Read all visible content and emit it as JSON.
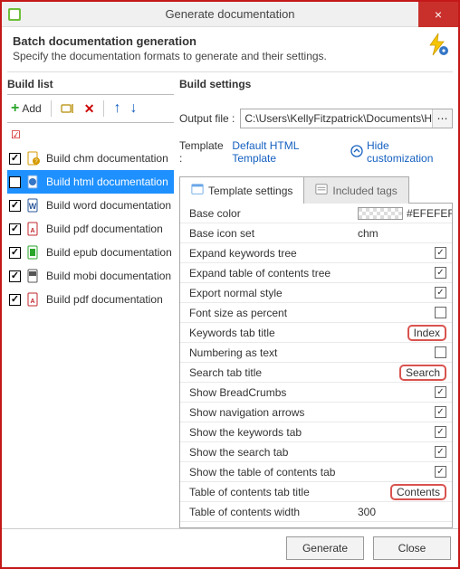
{
  "window": {
    "title": "Generate documentation",
    "close": "×"
  },
  "header": {
    "title": "Batch documentation generation",
    "subtitle": "Specify the documentation formats to generate and their settings."
  },
  "build_list": {
    "title": "Build list",
    "add_label": "Add",
    "items": [
      {
        "label": "Build chm documentation",
        "checked": true,
        "selected": false
      },
      {
        "label": "Build html documentation",
        "checked": false,
        "selected": true
      },
      {
        "label": "Build word documentation",
        "checked": true,
        "selected": false
      },
      {
        "label": "Build pdf documentation",
        "checked": true,
        "selected": false
      },
      {
        "label": "Build epub documentation",
        "checked": true,
        "selected": false
      },
      {
        "label": "Build mobi documentation",
        "checked": true,
        "selected": false
      },
      {
        "label": "Build pdf documentation",
        "checked": true,
        "selected": false
      }
    ]
  },
  "settings": {
    "title": "Build settings",
    "output_label": "Output file :",
    "output_value": "C:\\Users\\KellyFitzpatrick\\Documents\\HelpNDo",
    "template_label": "Template :",
    "template_value": "Default HTML Template",
    "hide_customization": "Hide customization",
    "tabs": {
      "template": "Template settings",
      "included": "Included tags"
    },
    "properties": [
      {
        "name": "Base color",
        "type": "color",
        "value": "#EFEFEF"
      },
      {
        "name": "Base icon set",
        "type": "text",
        "value": "chm"
      },
      {
        "name": "Expand keywords tree",
        "type": "check",
        "checked": true
      },
      {
        "name": "Expand table of contents tree",
        "type": "check",
        "checked": true
      },
      {
        "name": "Export normal style",
        "type": "check",
        "checked": true
      },
      {
        "name": "Font size as percent",
        "type": "check",
        "checked": false
      },
      {
        "name": "Keywords tab title",
        "type": "hltext",
        "value": "Index"
      },
      {
        "name": "Numbering as text",
        "type": "check",
        "checked": false
      },
      {
        "name": "Search tab title",
        "type": "hltext",
        "value": "Search"
      },
      {
        "name": "Show BreadCrumbs",
        "type": "check",
        "checked": true
      },
      {
        "name": "Show navigation arrows",
        "type": "check",
        "checked": true
      },
      {
        "name": "Show the keywords tab",
        "type": "check",
        "checked": true
      },
      {
        "name": "Show the search tab",
        "type": "check",
        "checked": true
      },
      {
        "name": "Show the table of contents tab",
        "type": "check",
        "checked": true
      },
      {
        "name": "Table of contents tab title",
        "type": "hltext",
        "value": "Contents"
      },
      {
        "name": "Table of contents width",
        "type": "text",
        "value": "300"
      }
    ]
  },
  "footer": {
    "generate": "Generate",
    "close": "Close"
  }
}
